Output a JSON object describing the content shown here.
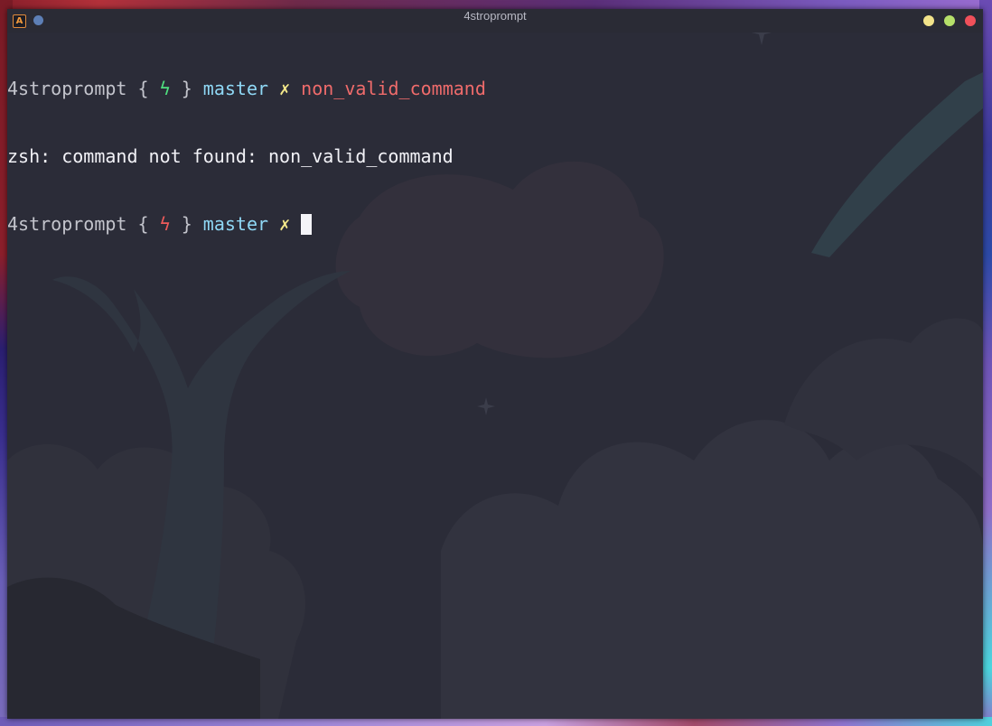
{
  "window": {
    "title": "4stroprompt",
    "app_icon_letter": "A"
  },
  "colors": {
    "terminal_bg": "#2b2c38",
    "prompt_text": "#c3c4cc",
    "bolt_success": "#4fe07f",
    "bolt_error": "#ef5b5b",
    "branch": "#8fd8f5",
    "dirty_mark": "#f4e98a",
    "error_command": "#ef6b6b",
    "minimize_button": "#f2e38a",
    "maximize_button": "#b6e06a",
    "close_button": "#f0505a"
  },
  "terminal": {
    "lines": [
      {
        "prompt": "4stroprompt",
        "open_brace": "{",
        "bolt": "ϟ",
        "close_brace": "}",
        "branch": "master",
        "dirty": "✗",
        "command": "non_valid_command"
      },
      {
        "output": "zsh: command not found: non_valid_command"
      },
      {
        "prompt": "4stroprompt",
        "open_brace": "{",
        "bolt": "ϟ",
        "close_brace": "}",
        "branch": "master",
        "dirty": "✗",
        "command": ""
      }
    ]
  },
  "icons": [
    "app-icon",
    "pin-icon",
    "bolt-icon",
    "dirty-mark-icon"
  ]
}
